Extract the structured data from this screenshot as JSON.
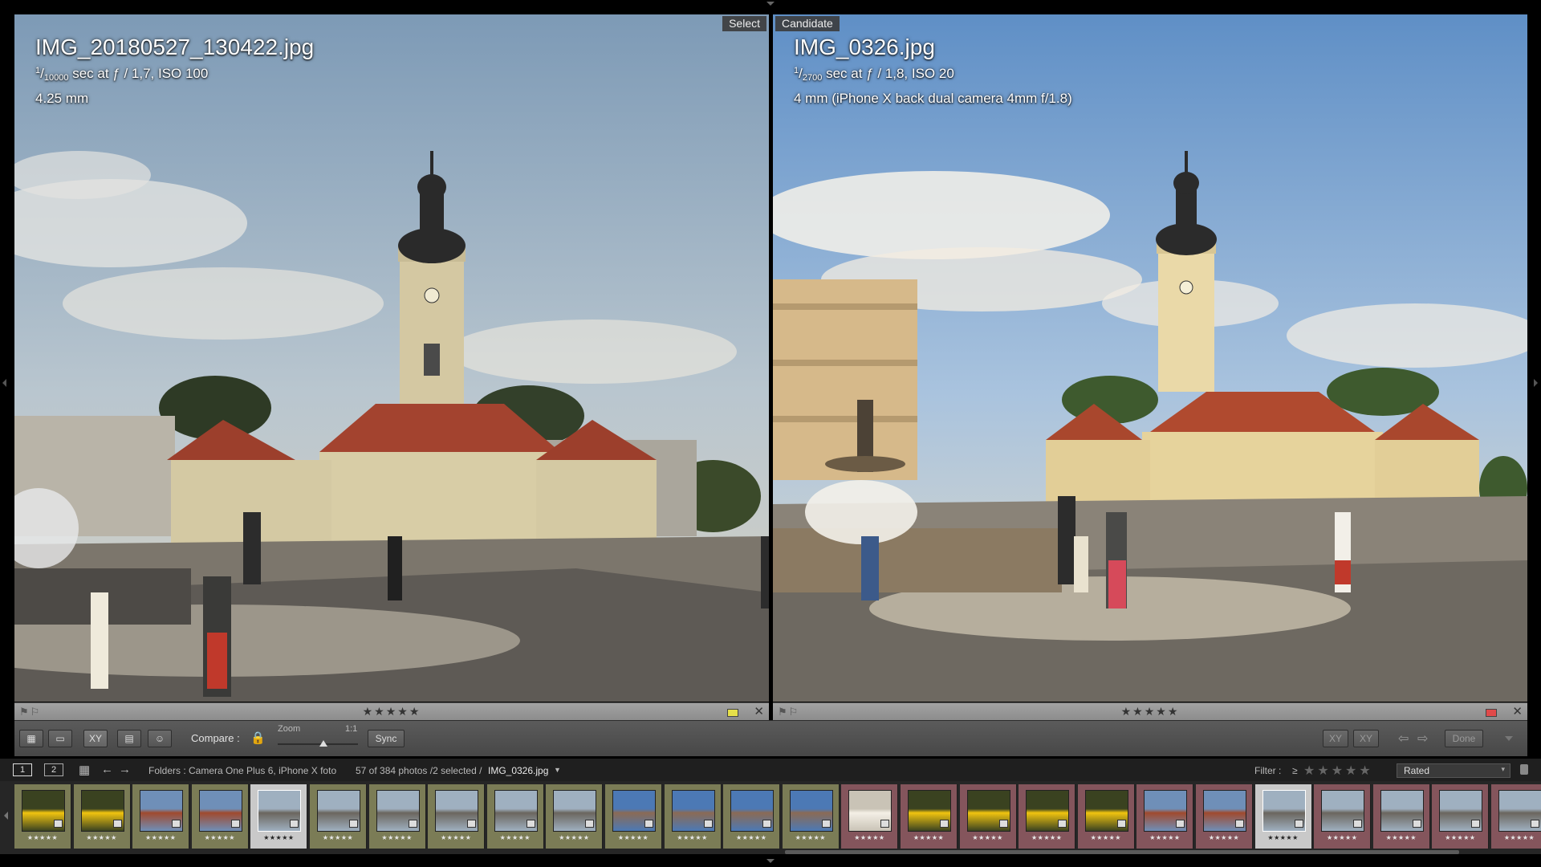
{
  "left": {
    "tag": "Select",
    "filename": "IMG_20180527_130422.jpg",
    "exposure_num": "1",
    "exposure_den": "10000",
    "exposure_rest": "sec at ƒ / 1,7, ISO 100",
    "lens": "4.25 mm",
    "rating": "★★★★★"
  },
  "right": {
    "tag": "Candidate",
    "filename": "IMG_0326.jpg",
    "exposure_num": "1",
    "exposure_den": "2700",
    "exposure_rest": "sec at ƒ / 1,8, ISO 20",
    "lens": "4 mm (iPhone X back dual camera 4mm f/1.8)",
    "rating": "★★★★★"
  },
  "toolbar": {
    "compare_label": "Compare :",
    "zoom_label": "Zoom",
    "zoom_value": "1:1",
    "sync_label": "Sync",
    "done_label": "Done",
    "view_xy": "XY",
    "swap_xy": "XY"
  },
  "filmstrip_header": {
    "screen1": "1",
    "screen2": "2",
    "folders": "Folders : Camera One Plus 6, iPhone X foto",
    "count": "57 of 384 photos /2 selected /",
    "selected_file": "IMG_0326.jpg",
    "filter_label": "Filter :",
    "filter_op": "≥",
    "filter_stars": "★★★★★",
    "filter_mode": "Rated"
  },
  "thumbs": [
    {
      "subject": "flower",
      "stars": "★★★★★"
    },
    {
      "subject": "flower",
      "stars": "★★★★★"
    },
    {
      "subject": "town",
      "stars": "★★★★★"
    },
    {
      "subject": "town",
      "stars": "★★★★★"
    },
    {
      "subject": "square",
      "stars": "★★★★★",
      "selected": true
    },
    {
      "subject": "square",
      "stars": "★★★★★"
    },
    {
      "subject": "square",
      "stars": "★★★★★"
    },
    {
      "subject": "square",
      "stars": "★★★★★"
    },
    {
      "subject": "square",
      "stars": "★★★★★"
    },
    {
      "subject": "square",
      "stars": "★★★★★"
    },
    {
      "subject": "person",
      "stars": "★★★★★"
    },
    {
      "subject": "person",
      "stars": "★★★★★"
    },
    {
      "subject": "person",
      "stars": "★★★★★"
    },
    {
      "subject": "person",
      "stars": "★★★★★"
    },
    {
      "subject": "dog",
      "stars": "★★★★★"
    },
    {
      "subject": "flower",
      "stars": "★★★★★"
    },
    {
      "subject": "flower",
      "stars": "★★★★★"
    },
    {
      "subject": "flower",
      "stars": "★★★★★"
    },
    {
      "subject": "flower",
      "stars": "★★★★★"
    },
    {
      "subject": "town",
      "stars": "★★★★★"
    },
    {
      "subject": "town",
      "stars": "★★★★★"
    },
    {
      "subject": "square",
      "stars": "★★★★★",
      "selected": true
    },
    {
      "subject": "square",
      "stars": "★★★★★"
    },
    {
      "subject": "square",
      "stars": "★★★★★"
    },
    {
      "subject": "square",
      "stars": "★★★★★"
    },
    {
      "subject": "square",
      "stars": "★★★★★"
    }
  ],
  "colors": {
    "select_label": "#e6e04a",
    "candidate_label": "#e04a4a",
    "film_green": "#7b7c56",
    "film_red": "#84555c"
  }
}
